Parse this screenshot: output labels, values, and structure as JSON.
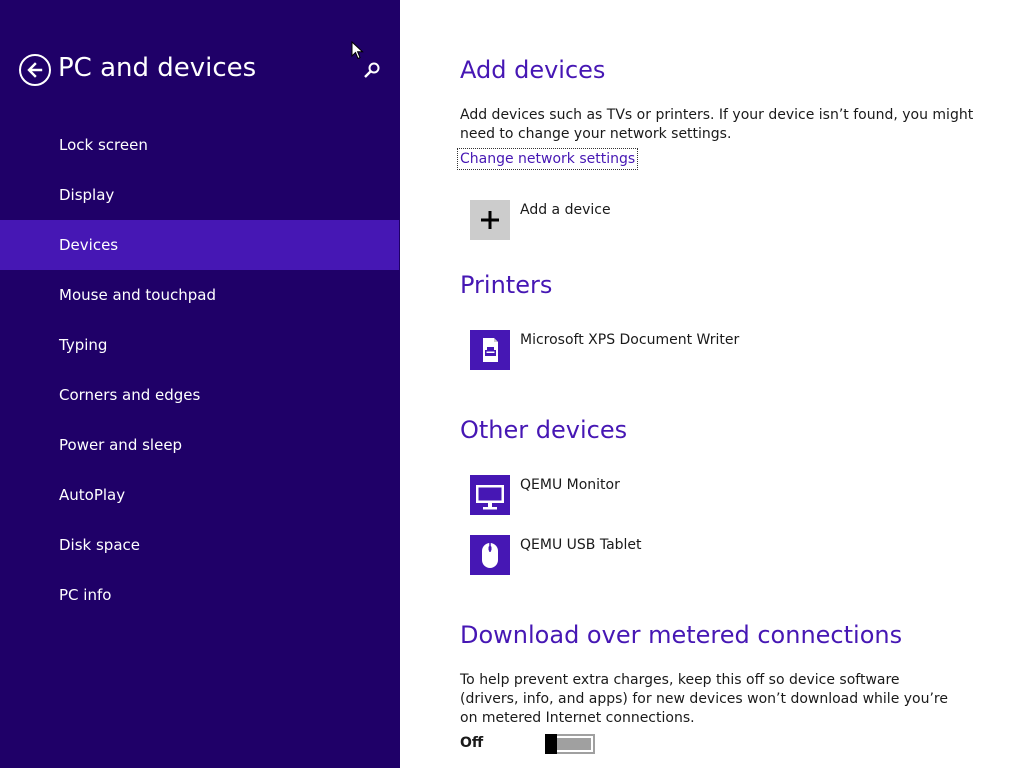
{
  "sidebar": {
    "title": "PC and devices",
    "back_icon": "back-arrow-icon",
    "search_icon": "search-icon",
    "items": [
      {
        "label": "Lock screen"
      },
      {
        "label": "Display"
      },
      {
        "label": "Devices",
        "selected": true
      },
      {
        "label": "Mouse and touchpad"
      },
      {
        "label": "Typing"
      },
      {
        "label": "Corners and edges"
      },
      {
        "label": "Power and sleep"
      },
      {
        "label": "AutoPlay"
      },
      {
        "label": "Disk space"
      },
      {
        "label": "PC info"
      }
    ]
  },
  "add_devices": {
    "heading": "Add devices",
    "description": "Add devices such as TVs or printers. If your device isn’t found, you might need to change your network settings.",
    "link": "Change network settings",
    "add_button_label": "Add a device"
  },
  "printers": {
    "heading": "Printers",
    "items": [
      {
        "label": "Microsoft XPS Document Writer",
        "icon": "printer-icon"
      }
    ]
  },
  "other_devices": {
    "heading": "Other devices",
    "items": [
      {
        "label": "QEMU Monitor",
        "icon": "monitor-icon"
      },
      {
        "label": "QEMU USB Tablet",
        "icon": "mouse-icon"
      }
    ]
  },
  "metered": {
    "heading": "Download over metered connections",
    "description": "To help prevent extra charges, keep this off so device software (drivers, info, and apps) for new devices won’t download while you’re on metered Internet connections.",
    "toggle_state": "Off"
  },
  "colors": {
    "sidebar_bg": "#1f0068",
    "selected_bg": "#4617b4",
    "accent": "#4617b4"
  }
}
